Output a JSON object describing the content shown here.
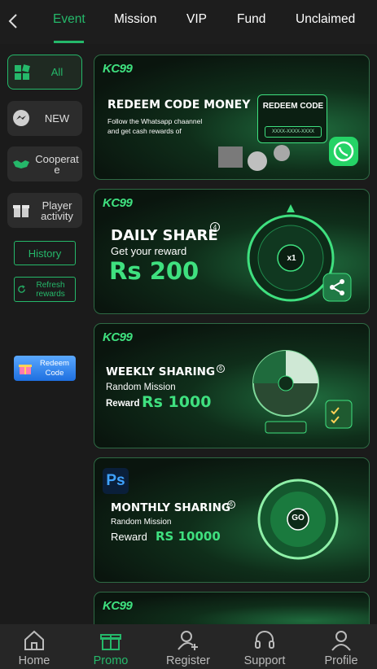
{
  "tabs": [
    {
      "label": "Event",
      "active": true
    },
    {
      "label": "Mission"
    },
    {
      "label": "VIP"
    },
    {
      "label": "Fund"
    },
    {
      "label": "Unclaimed"
    }
  ],
  "sidebar": {
    "items": [
      {
        "label": "All",
        "icon": "grid-icon",
        "active": true
      },
      {
        "label": "NEW",
        "icon": "messenger-icon"
      },
      {
        "label": "Cooperat e",
        "icon": "handshake-icon"
      },
      {
        "label": "Player activity",
        "icon": "gift-box-icon"
      }
    ],
    "history_label": "History",
    "refresh_label": "Refresh rewards",
    "redeem_label": "Redeem Code"
  },
  "banners": [
    {
      "logo": "KC99",
      "title": "REDEEM CODE MONEY",
      "subtitle": "Follow the Whatsapp chaannel and get cash rewards of",
      "card_title": "REDEEM CODE",
      "card_code": "XXXX-XXXX-XXXX"
    },
    {
      "logo": "KC99",
      "title": "DAILY SHARE",
      "badge": "4",
      "subtitle": "Get your reward",
      "amount": "Rs 200",
      "wheel_center": "x1"
    },
    {
      "logo": "KC99",
      "title": "WEEKLY SHARING",
      "badge": "6",
      "subtitle": "Random Mission",
      "reward_label": "Reward",
      "amount": "Rs 1000"
    },
    {
      "logo": "Ps",
      "title": "MONTHLY SHARING",
      "badge": "6",
      "subtitle": "Random Mission",
      "reward_label": "Reward",
      "amount": "RS 10000",
      "wheel_center": "GO"
    },
    {
      "logo": "KC99"
    }
  ],
  "bottom_nav": [
    {
      "label": "Home",
      "icon": "home-icon"
    },
    {
      "label": "Promo",
      "icon": "gift-icon",
      "active": true
    },
    {
      "label": "Register",
      "icon": "add-user-icon"
    },
    {
      "label": "Support",
      "icon": "headset-icon"
    },
    {
      "label": "Profile",
      "icon": "user-icon"
    }
  ],
  "colors": {
    "accent": "#25b86a",
    "background": "#1b1b1b"
  }
}
